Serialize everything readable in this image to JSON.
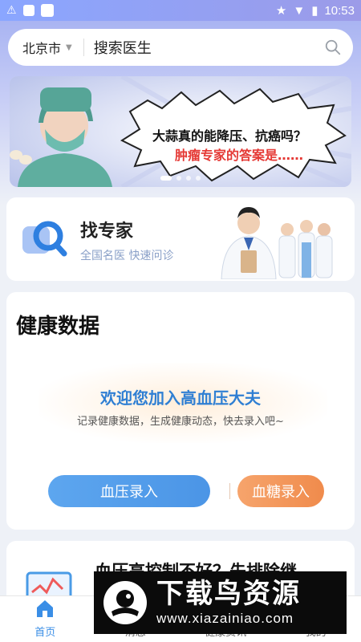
{
  "status_bar": {
    "time": "10:53"
  },
  "search": {
    "city": "北京市",
    "placeholder": "搜索医生"
  },
  "banner": {
    "headline_line1": "大蒜真的能降压、抗癌吗？",
    "headline_line2": "肿瘤专家的答案是……",
    "dot_count": 4,
    "active_dot": 0
  },
  "expert_card": {
    "title": "找专家",
    "subtitle": "全国名医  快速问诊"
  },
  "health_card": {
    "title": "健康数据",
    "welcome": "欢迎您加入高血压大夫",
    "welcome_sub": "记录健康数据，生成健康动态，快去录入吧~",
    "primary_button": "血压录入",
    "secondary_button": "血糖录入"
  },
  "article": {
    "title": "血压高控制不好？先排除继"
  },
  "bottom_nav": {
    "items": [
      {
        "label": "首页",
        "active": true
      },
      {
        "label": "消息",
        "active": false
      },
      {
        "label": "健康资讯",
        "active": false
      },
      {
        "label": "我的",
        "active": false
      }
    ]
  },
  "watermark": {
    "text": "下载鸟资源",
    "url": "www.xiazainiao.com"
  },
  "colors": {
    "accent": "#3a8ee6",
    "orange": "#f08b4c",
    "header": "#a9b4f2"
  }
}
